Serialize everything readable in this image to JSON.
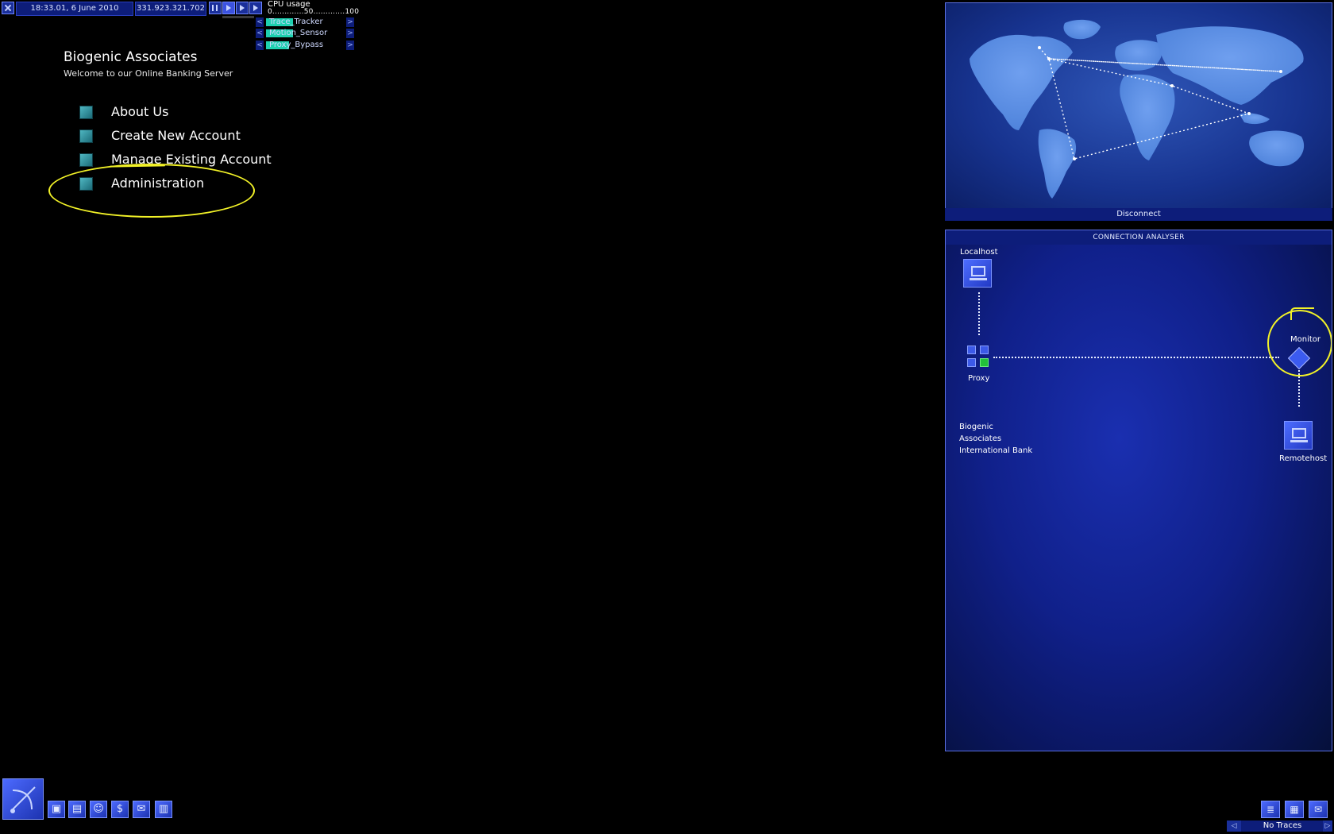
{
  "hud": {
    "datetime": "18:33.01, 6 June 2010",
    "ip": "331.923.321.702",
    "cpu": {
      "title": "CPU usage",
      "scale": "0.............50.............100"
    },
    "tools": [
      {
        "name": "Trace_Tracker",
        "fill": 0.35
      },
      {
        "name": "Motion_Sensor",
        "fill": 0.35
      },
      {
        "name": "Proxy_Bypass",
        "fill": 0.3
      }
    ]
  },
  "bank": {
    "title": "Biogenic Associates",
    "subtitle": "Welcome to our Online Banking Server",
    "menu": [
      {
        "label": "About Us"
      },
      {
        "label": "Create New Account"
      },
      {
        "label": "Manage Existing Account"
      },
      {
        "label": "Administration"
      }
    ]
  },
  "map": {
    "disconnect_label": "Disconnect"
  },
  "analyser": {
    "header": "CONNECTION ANALYSER",
    "localhost": "Localhost",
    "proxy": "Proxy",
    "monitor": "Monitor",
    "remotehost": "Remotehost",
    "target_lines": [
      "Biogenic",
      "Associates",
      "International Bank"
    ]
  },
  "traces": {
    "label": "No Traces"
  },
  "colors": {
    "accent": "#1ed1b0",
    "annotation": "#f2f227",
    "panel": "#0d1d7a"
  }
}
